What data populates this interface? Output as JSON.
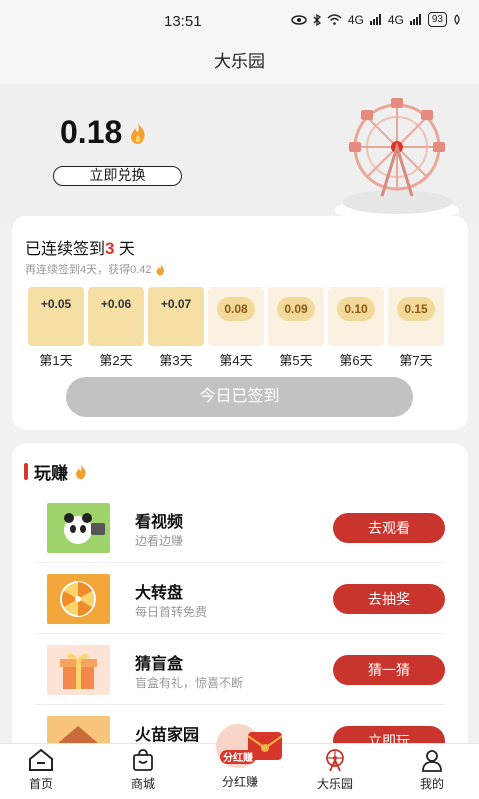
{
  "status": {
    "time": "13:51",
    "battery": "93",
    "net1": "4G",
    "net2": "4G"
  },
  "nav": {
    "title": "大乐园"
  },
  "hero": {
    "balance": "0.18",
    "redeem_label": "立即兑换"
  },
  "signin": {
    "title_prefix": "已连续签到",
    "streak": "3",
    "title_suffix": " 天",
    "subtitle": "再连续签到4天，获得0.42",
    "days": [
      {
        "value": "+0.05",
        "label": "第1天",
        "done": true
      },
      {
        "value": "+0.06",
        "label": "第2天",
        "done": true
      },
      {
        "value": "+0.07",
        "label": "第3天",
        "done": true
      },
      {
        "value": "0.08",
        "label": "第4天",
        "done": false
      },
      {
        "value": "0.09",
        "label": "第5天",
        "done": false
      },
      {
        "value": "0.10",
        "label": "第6天",
        "done": false
      },
      {
        "value": "0.15",
        "label": "第7天",
        "done": false
      }
    ],
    "button_label": "今日已签到"
  },
  "earn": {
    "title": "玩赚",
    "tasks": [
      {
        "name": "看视频",
        "desc": "边看边赚",
        "button": "去观看",
        "icon": "panda-video-icon"
      },
      {
        "name": "大转盘",
        "desc": "每日首转免费",
        "button": "去抽奖",
        "icon": "wheel-icon"
      },
      {
        "name": "猜盲盒",
        "desc": "盲盒有礼，惊喜不断",
        "button": "猜一猜",
        "icon": "gift-box-icon"
      },
      {
        "name": "火苗家园",
        "desc": "",
        "button": "立即玩",
        "icon": "house-icon"
      }
    ]
  },
  "float_badge": {
    "label": "分红赚"
  },
  "tabs": [
    {
      "label": "首页",
      "icon": "home-icon"
    },
    {
      "label": "商城",
      "icon": "shopping-bag-icon"
    },
    {
      "label": "分红赚",
      "icon": "red-envelope-icon"
    },
    {
      "label": "大乐园",
      "icon": "ferris-wheel-icon"
    },
    {
      "label": "我的",
      "icon": "user-icon"
    }
  ],
  "colors": {
    "accent": "#c9342c",
    "gold": "#f5dfa4",
    "pending": "#fbf1e1"
  }
}
